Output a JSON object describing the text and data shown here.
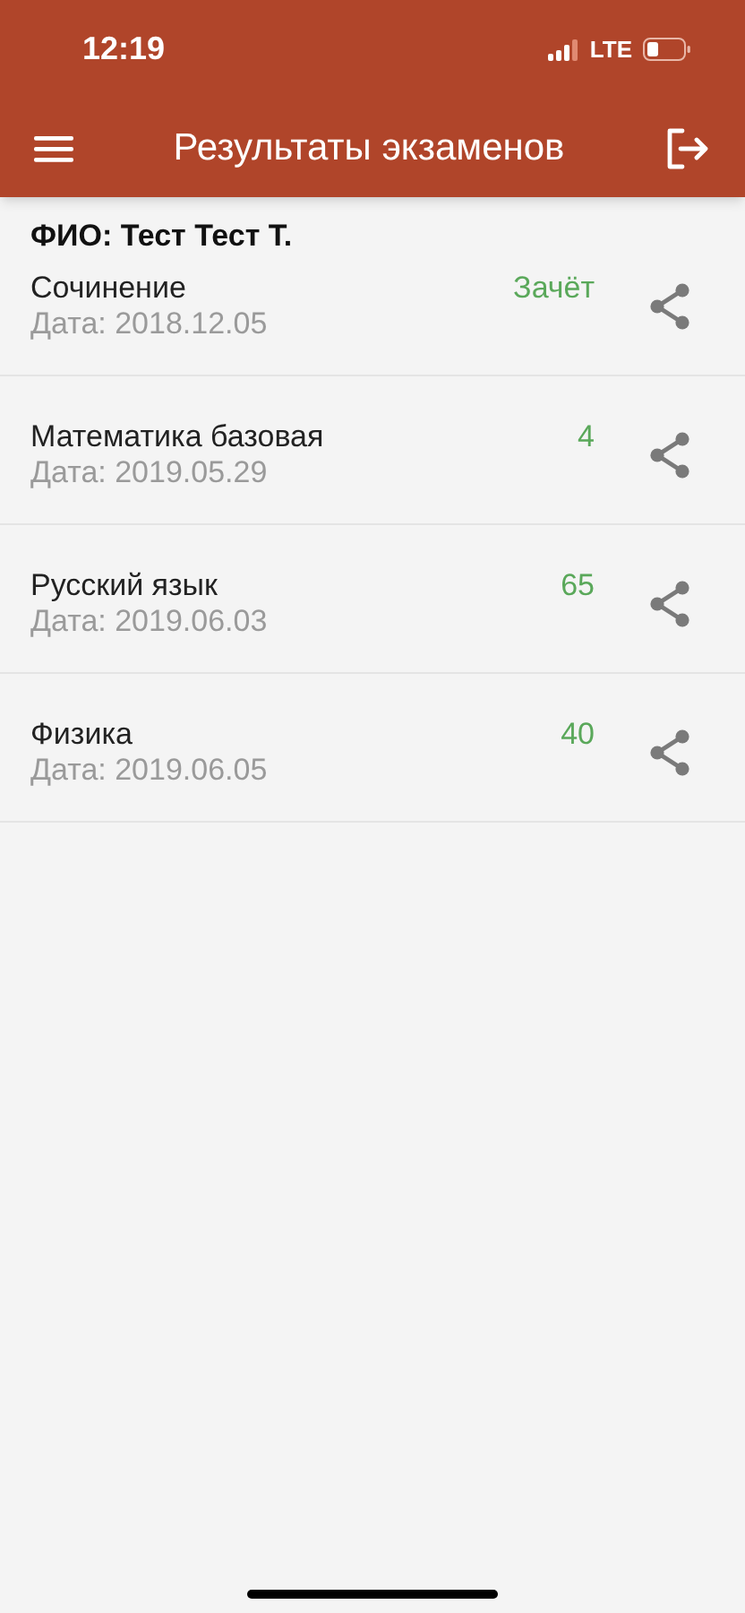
{
  "status_bar": {
    "time": "12:19",
    "network": "LTE"
  },
  "app_bar": {
    "title": "Результаты экзаменов"
  },
  "student": {
    "label": "ФИО: Тест Тест Т."
  },
  "results": [
    {
      "subject": "Сочинение",
      "date": "Дата: 2018.12.05",
      "score": "Зачёт"
    },
    {
      "subject": "Математика базовая",
      "date": "Дата: 2019.05.29",
      "score": "4"
    },
    {
      "subject": "Русский язык",
      "date": "Дата: 2019.06.03",
      "score": "65"
    },
    {
      "subject": "Физика",
      "date": "Дата: 2019.06.05",
      "score": "40"
    }
  ]
}
